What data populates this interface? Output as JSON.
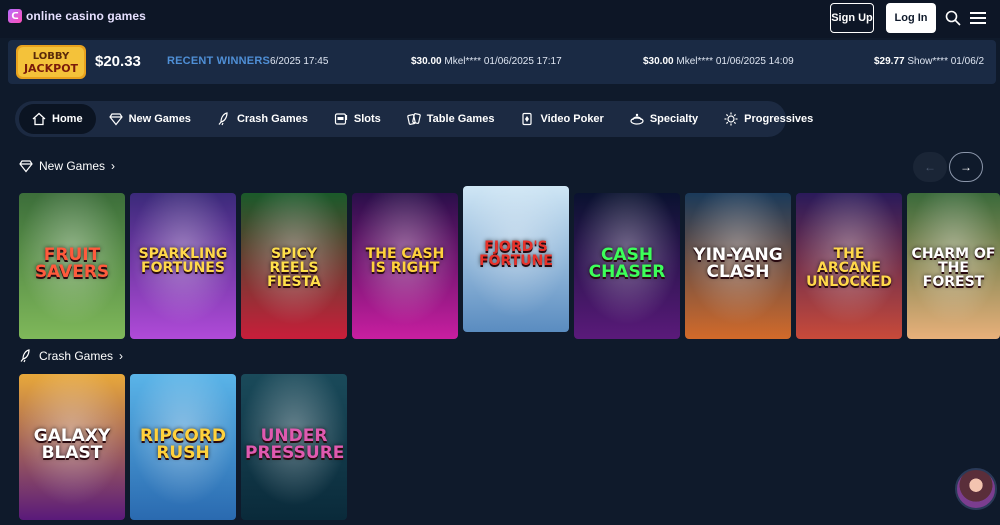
{
  "header": {
    "logo_mark": "ᑕ",
    "logo_text": "online casino games",
    "signup_label": "Sign Up",
    "login_label": "Log In"
  },
  "ticker": {
    "jackpot_line1": "LOBBY",
    "jackpot_line2": "JACKPOT",
    "jackpot_amount": "$20.33",
    "recent_label": "RECENT WINNERS",
    "entries": [
      {
        "amount": "",
        "text": "6/2025 17:45"
      },
      {
        "amount": "$30.00",
        "text": "Mkel**** 01/06/2025 17:17"
      },
      {
        "amount": "$30.00",
        "text": "Mkel**** 01/06/2025 14:09"
      },
      {
        "amount": "$29.77",
        "text": "Show**** 01/06/2"
      }
    ]
  },
  "nav": {
    "items": [
      {
        "label": "Home",
        "icon": "home-icon"
      },
      {
        "label": "New Games",
        "icon": "diamond-icon"
      },
      {
        "label": "Crash Games",
        "icon": "rocket-icon"
      },
      {
        "label": "Slots",
        "icon": "slot-machine-icon"
      },
      {
        "label": "Table Games",
        "icon": "cards-icon"
      },
      {
        "label": "Video Poker",
        "icon": "poker-icon"
      },
      {
        "label": "Specialty",
        "icon": "specialty-icon"
      },
      {
        "label": "Progressives",
        "icon": "sun-icon"
      }
    ]
  },
  "sections": {
    "new_games": {
      "title": "New Games",
      "chevron": "›",
      "prev_arrow": "←",
      "next_arrow": "→",
      "games": [
        {
          "title": "Fruit Savers",
          "colors": [
            "#3c6e3a",
            "#7fb85a"
          ],
          "text_color": "#ff5a3c"
        },
        {
          "title": "Sparkling Fortunes",
          "colors": [
            "#3b2a7a",
            "#b04ad8"
          ],
          "text_color": "#ffd84a"
        },
        {
          "title": "Spicy Reels Fiesta",
          "colors": [
            "#1a5a2a",
            "#c81e3a"
          ],
          "text_color": "#ffe04a"
        },
        {
          "title": "The Cash is Right",
          "colors": [
            "#2a0f4a",
            "#c81ea0"
          ],
          "text_color": "#ffd23c"
        },
        {
          "title": "Fjord's Fortune",
          "colors": [
            "#cfe6f5",
            "#5a8cc0"
          ],
          "text_color": "#e8322a"
        },
        {
          "title": "Cash Chaser",
          "colors": [
            "#0a1230",
            "#5a1a7a"
          ],
          "text_color": "#3cff5a"
        },
        {
          "title": "Yin-Yang Clash",
          "colors": [
            "#1a3a5a",
            "#d26a2a"
          ],
          "text_color": "#ffffff"
        },
        {
          "title": "The Arcane Unlocked",
          "colors": [
            "#2a1a5a",
            "#c84a3a"
          ],
          "text_color": "#ffd84a"
        },
        {
          "title": "Charm of the Forest",
          "colors": [
            "#3a6a3a",
            "#e8b07a"
          ],
          "text_color": "#ffffff"
        }
      ]
    },
    "crash_games": {
      "title": "Crash Games",
      "chevron": "›",
      "games": [
        {
          "title": "Galaxy Blast",
          "colors": [
            "#e8a83a",
            "#5a1a7a"
          ],
          "text_color": "#ffffff"
        },
        {
          "title": "Ripcord Rush",
          "colors": [
            "#5ab4e8",
            "#2a6ab0"
          ],
          "text_color": "#ffd23c"
        },
        {
          "title": "Under Pressure",
          "colors": [
            "#1a4a5a",
            "#0a2a3a"
          ],
          "text_color": "#e05ab0"
        }
      ]
    }
  }
}
